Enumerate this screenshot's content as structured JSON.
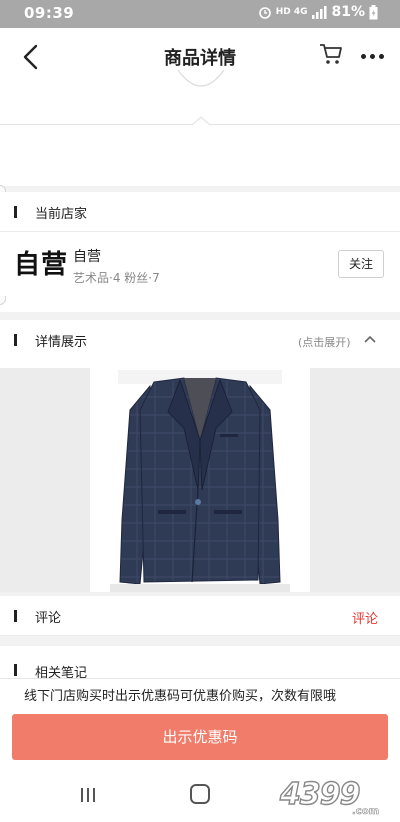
{
  "status_bar": {
    "time": "09:39",
    "network": "HD 4G",
    "battery": "81%"
  },
  "nav": {
    "title": "商品详情",
    "back_icon": "chevron-left-icon",
    "cart_icon": "cart-icon",
    "more_icon": "more-dots-icon"
  },
  "store_section": {
    "header": "当前店家",
    "logo_text": "自营",
    "store_name": "自营",
    "meta": "艺术品·4 粉丝·7",
    "follow_label": "关注"
  },
  "detail_section": {
    "header": "详情展示",
    "expand_hint": "(点击展开)",
    "product_image": "navy plaid blazer"
  },
  "review_section": {
    "header": "评论",
    "link": "评论"
  },
  "notes_section": {
    "header": "相关笔记"
  },
  "promo": {
    "notice": "线下门店购买时出示优惠码可优惠价购买，次数有限哦",
    "button": "出示优惠码"
  },
  "watermark": "4399.com",
  "colors": {
    "accent_red": "#e53935",
    "cta": "#f27c6a",
    "statusbar": "#a8a8a8"
  }
}
